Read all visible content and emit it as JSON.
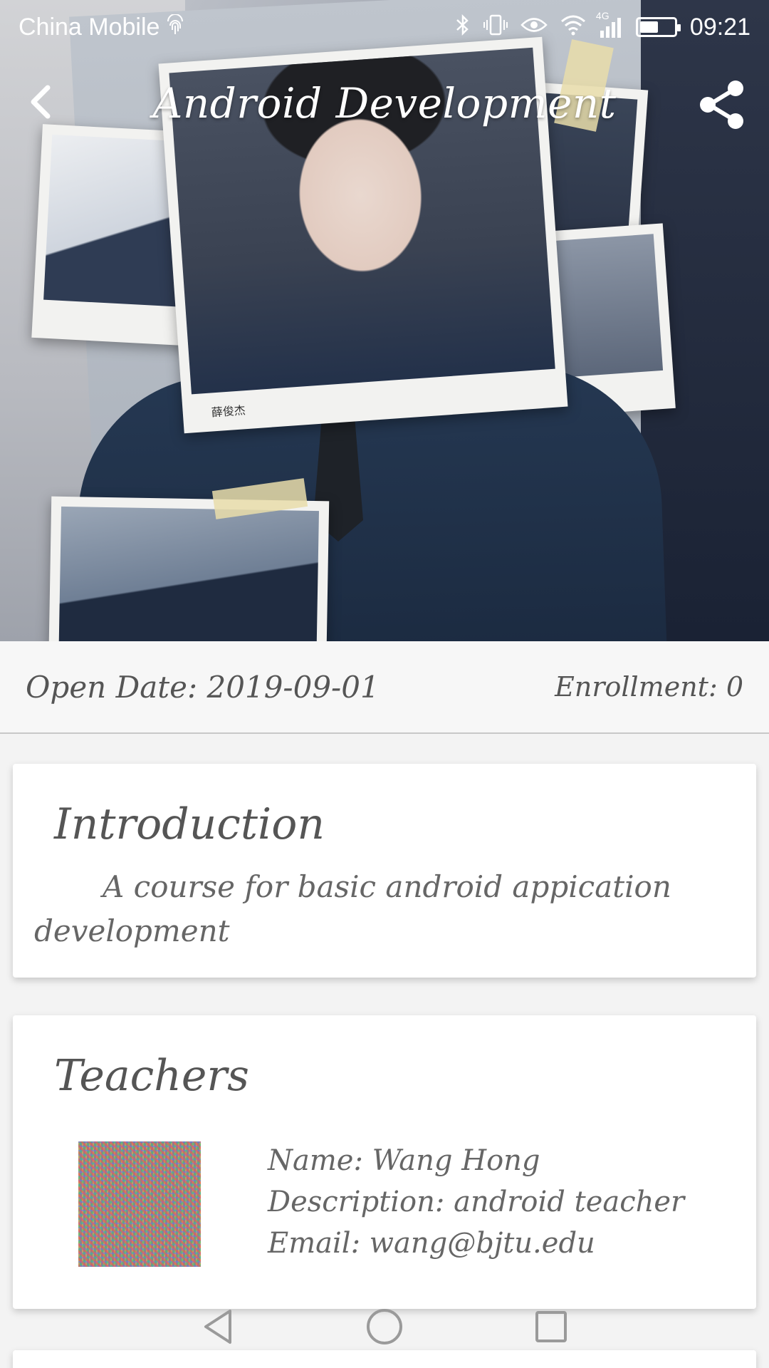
{
  "status_bar": {
    "carrier": "China Mobile",
    "network": "4G",
    "time": "09:21",
    "battery_level": 0.55
  },
  "toolbar": {
    "title": "Android Development",
    "back_icon": "chevron-left-icon",
    "share_icon": "share-icon"
  },
  "hero": {
    "photo_caption": "薛俊杰"
  },
  "course_info": {
    "open_date": "Open Date: 2019-09-01",
    "enrollment": "Enrollment: 0"
  },
  "introduction": {
    "heading": "Introduction",
    "text": "A course for basic android appication development"
  },
  "teachers": {
    "heading": "Teachers",
    "items": [
      {
        "name": "Name: Wang Hong",
        "description": "Description: android teacher",
        "email": "Email: wang@bjtu.edu"
      }
    ]
  },
  "nav_bar": {
    "back": "triangle-back-icon",
    "home": "circle-home-icon",
    "recents": "square-recents-icon"
  },
  "colors": {
    "text_gray": "#555555",
    "card_bg": "#ffffff",
    "page_bg": "#f3f3f3"
  }
}
